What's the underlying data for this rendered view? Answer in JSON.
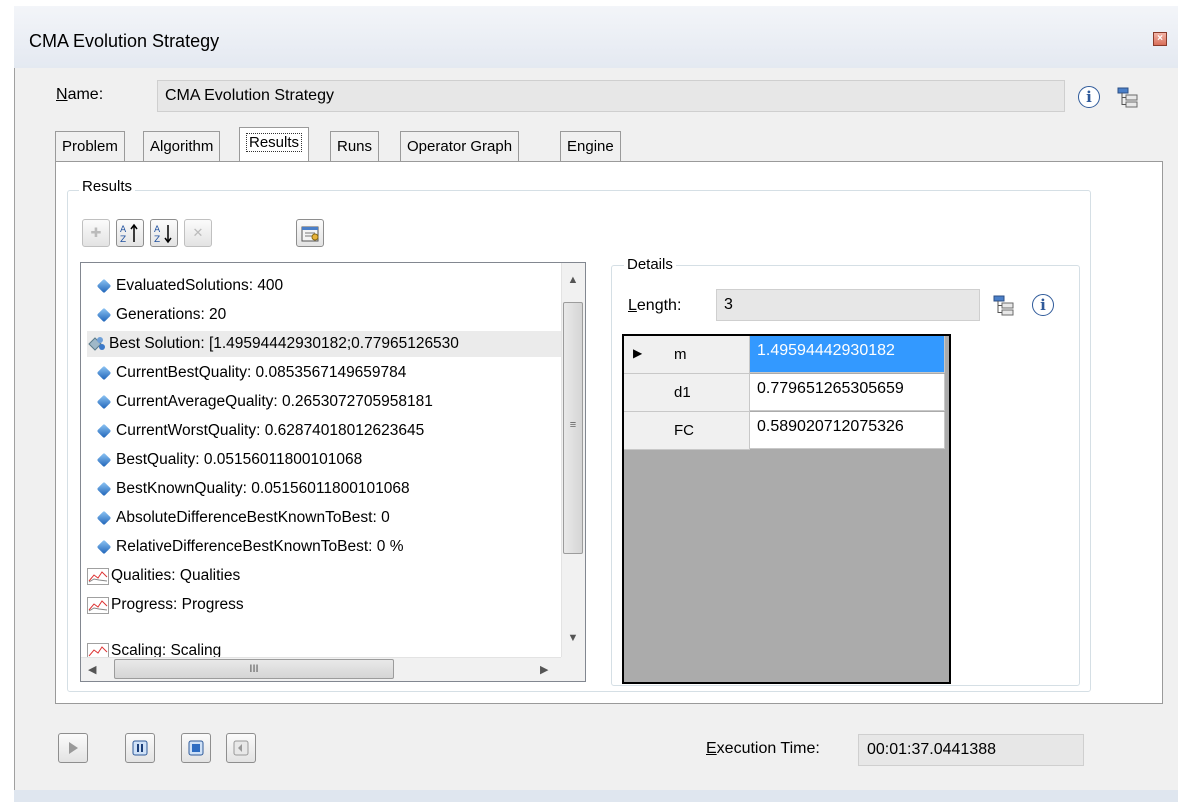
{
  "window": {
    "title": "CMA Evolution Strategy"
  },
  "name": {
    "label": "Name:",
    "value": "CMA Evolution Strategy"
  },
  "tabs": [
    {
      "label": "Problem",
      "active": false
    },
    {
      "label": "Algorithm",
      "active": false
    },
    {
      "label": "Results",
      "active": true
    },
    {
      "label": "Runs",
      "active": false
    },
    {
      "label": "Operator Graph",
      "active": false
    },
    {
      "label": "Engine",
      "active": false
    }
  ],
  "results": {
    "group_label": "Results",
    "items": [
      {
        "text": "EvaluatedSolutions: 400",
        "icon": "value-icon"
      },
      {
        "text": "Generations: 20",
        "icon": "value-icon"
      },
      {
        "text": "Best Solution: [1.49594442930182;0.77965126530",
        "icon": "solution-icon",
        "selected": true
      },
      {
        "text": "CurrentBestQuality: 0.0853567149659784",
        "icon": "value-icon"
      },
      {
        "text": "CurrentAverageQuality: 0.2653072705958181",
        "icon": "value-icon"
      },
      {
        "text": "CurrentWorstQuality: 0.62874018012623645",
        "icon": "value-icon"
      },
      {
        "text": "BestQuality: 0.05156011800101068",
        "icon": "value-icon"
      },
      {
        "text": "BestKnownQuality: 0.05156011800101068",
        "icon": "value-icon"
      },
      {
        "text": "AbsoluteDifferenceBestKnownToBest: 0",
        "icon": "value-icon"
      },
      {
        "text": "RelativeDifferenceBestKnownToBest: 0 %",
        "icon": "value-icon"
      },
      {
        "text": "Qualities: Qualities",
        "icon": "chart-icon"
      },
      {
        "text": "Progress: Progress",
        "icon": "chart-icon"
      },
      {
        "text": "Scaling: Scaling",
        "icon": "chart-icon"
      }
    ],
    "hscroll_label": "III"
  },
  "details": {
    "group_label": "Details",
    "length_label": "Length:",
    "length_value": "3",
    "rows": [
      {
        "label": "m",
        "value": "1.49594442930182",
        "selected": true
      },
      {
        "label": "d1",
        "value": "0.779651265305659",
        "selected": false
      },
      {
        "label": "FC",
        "value": "0.589020712075326",
        "selected": false
      }
    ]
  },
  "execution": {
    "label": "Execution Time:",
    "value": "00:01:37.0441388"
  },
  "colors": {
    "selection": "#3399ff",
    "grid_background": "#ababab",
    "tab_border": "#9a9a9a"
  }
}
